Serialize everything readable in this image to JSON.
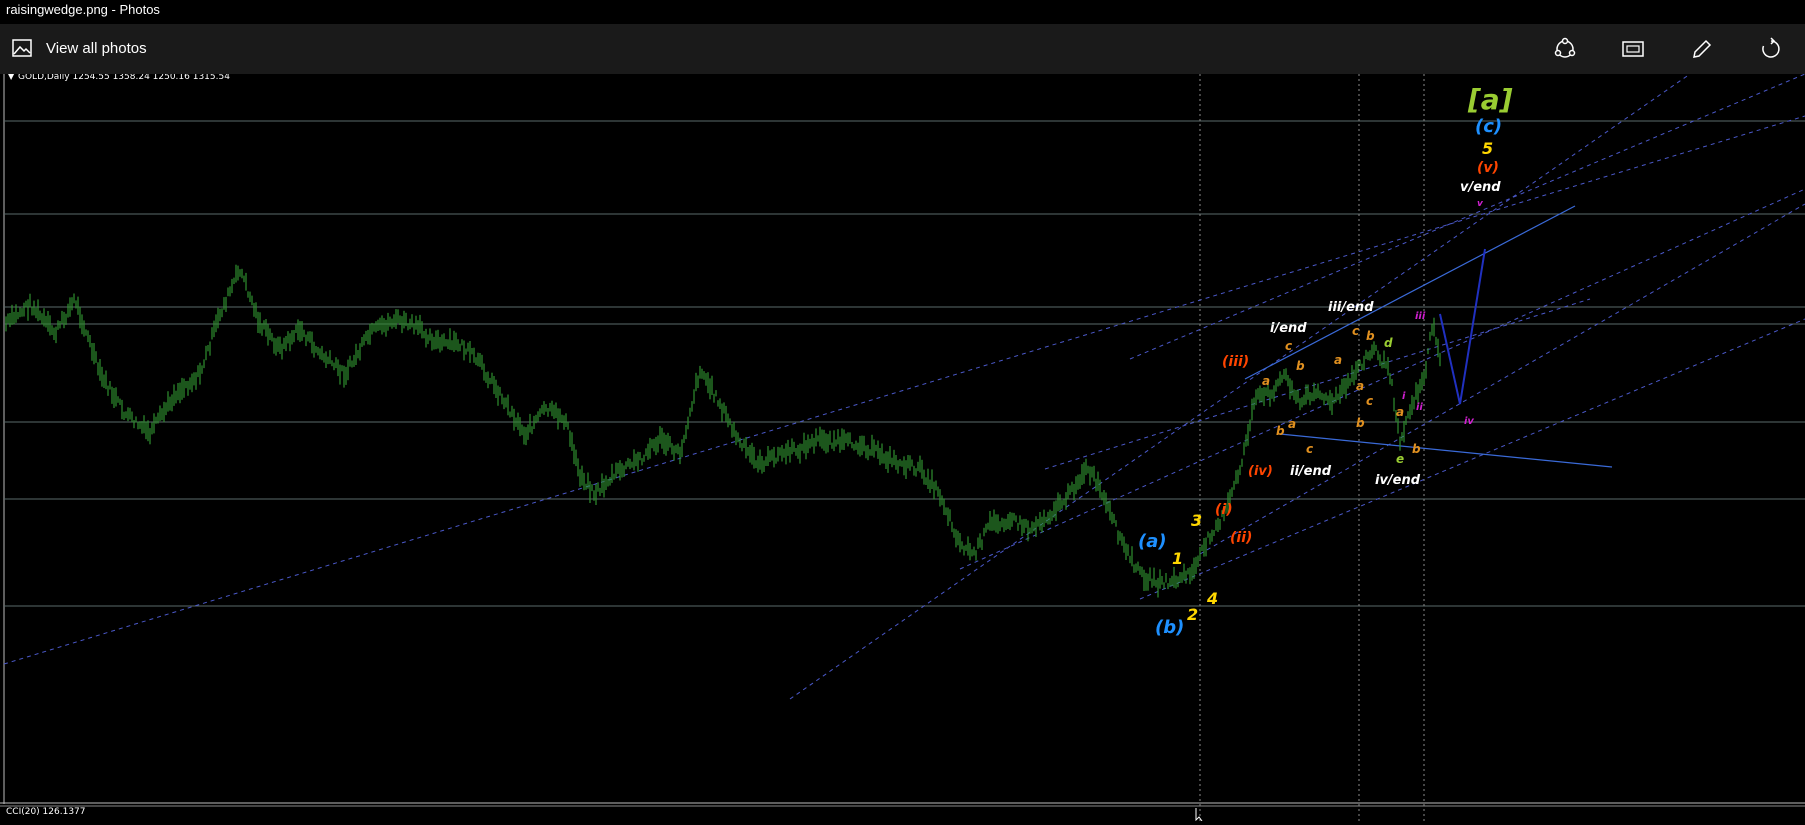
{
  "window": {
    "title": "raisingwedge.png - Photos"
  },
  "toolbar": {
    "view_all_label": "View all photos",
    "icons": [
      "photos-icon",
      "share-icon",
      "slideshow-icon",
      "edit-icon",
      "rotate-icon"
    ]
  },
  "chart": {
    "symbol_header": "GOLD,Daily  1254.55 1358.24 1250.16 1315.54",
    "indicator_label": "CCI(20) 126.1377",
    "price_color": "#2f8f2f",
    "wave_labels": [
      {
        "text": "[a]",
        "color": "#9acd32"
      },
      {
        "text": "(c)",
        "color": "#1e90ff"
      },
      {
        "text": "5",
        "color": "#ffd700"
      },
      {
        "text": "(v)",
        "color": "#ff4500"
      },
      {
        "text": "v/end",
        "color": "#ffffff"
      },
      {
        "text": "v",
        "color": "#d020d0"
      },
      {
        "text": "iii/end",
        "color": "#ffffff"
      },
      {
        "text": "i/end",
        "color": "#ffffff"
      },
      {
        "text": "(iii)",
        "color": "#ff4500"
      },
      {
        "text": "(iv)",
        "color": "#ff4500"
      },
      {
        "text": "ii/end",
        "color": "#ffffff"
      },
      {
        "text": "iv/end",
        "color": "#ffffff"
      },
      {
        "text": "(i)",
        "color": "#ff4500"
      },
      {
        "text": "(ii)",
        "color": "#ff4500"
      },
      {
        "text": "3",
        "color": "#ffd700"
      },
      {
        "text": "(a)",
        "color": "#1e90ff"
      },
      {
        "text": "1",
        "color": "#ffd700"
      },
      {
        "text": "4",
        "color": "#ffd700"
      },
      {
        "text": "2",
        "color": "#ffd700"
      },
      {
        "text": "(b)",
        "color": "#1e90ff"
      },
      {
        "text": "iii",
        "color": "#d020d0"
      },
      {
        "text": "ii",
        "color": "#d020d0"
      },
      {
        "text": "iv",
        "color": "#d020d0"
      },
      {
        "text": "i",
        "color": "#d020d0"
      },
      {
        "text": "a",
        "color": "#e09020"
      },
      {
        "text": "b",
        "color": "#e09020"
      },
      {
        "text": "c",
        "color": "#e09020"
      },
      {
        "text": "d",
        "color": "#9acd32"
      },
      {
        "text": "e",
        "color": "#9acd32"
      }
    ]
  }
}
